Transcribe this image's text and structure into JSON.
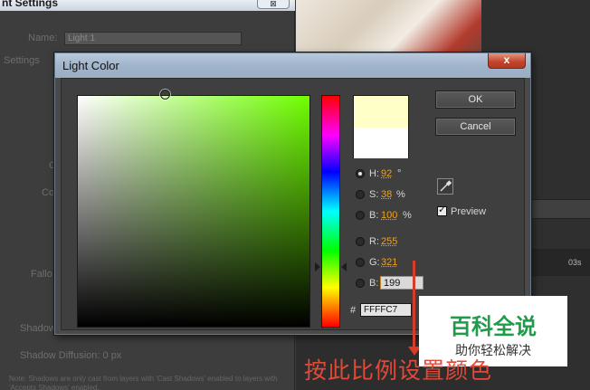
{
  "background_window": {
    "title": "nt Settings",
    "close_label": "⊠",
    "name_label": "Name:",
    "name_value": "Light 1",
    "settings_label": "Settings",
    "fragment_c": "C",
    "fragment_co": "Co",
    "falloff_label": "Fallo",
    "shadow_label": "Shadow",
    "shadow_diffusion": "Shadow Diffusion:  0 px",
    "note": "Note: Shadows are only cast from layers with 'Cast Shadows' enabled to layers with 'Accepts Shadows' enabled."
  },
  "timeline": {
    "time_marker": "03s"
  },
  "dialog": {
    "title": "Light Color",
    "close_label": "x",
    "ok_label": "OK",
    "cancel_label": "Cancel",
    "preview_label": "Preview",
    "preview_checked": true,
    "channels": {
      "h": {
        "label": "H:",
        "value": "92",
        "unit": "°",
        "selected": true
      },
      "s": {
        "label": "S:",
        "value": "38",
        "unit": "%"
      },
      "b_hsb": {
        "label": "B:",
        "value": "100",
        "unit": "%"
      },
      "r": {
        "label": "R:",
        "value": "255"
      },
      "g": {
        "label": "G:",
        "value": "321"
      },
      "b_rgb": {
        "label": "B:",
        "value": "199"
      }
    },
    "hex_label": "#",
    "hex_value": "FFFFC7",
    "new_color": "#ffffc7",
    "old_color": "#ffffff",
    "field_hue_color": "#6fff00"
  },
  "annotation": {
    "text": "按此比例设置颜色",
    "color": "#e14a38"
  },
  "watermark": {
    "title": "百科全说",
    "subtitle": "助你轻松解决",
    "color": "#1f9c4a"
  }
}
